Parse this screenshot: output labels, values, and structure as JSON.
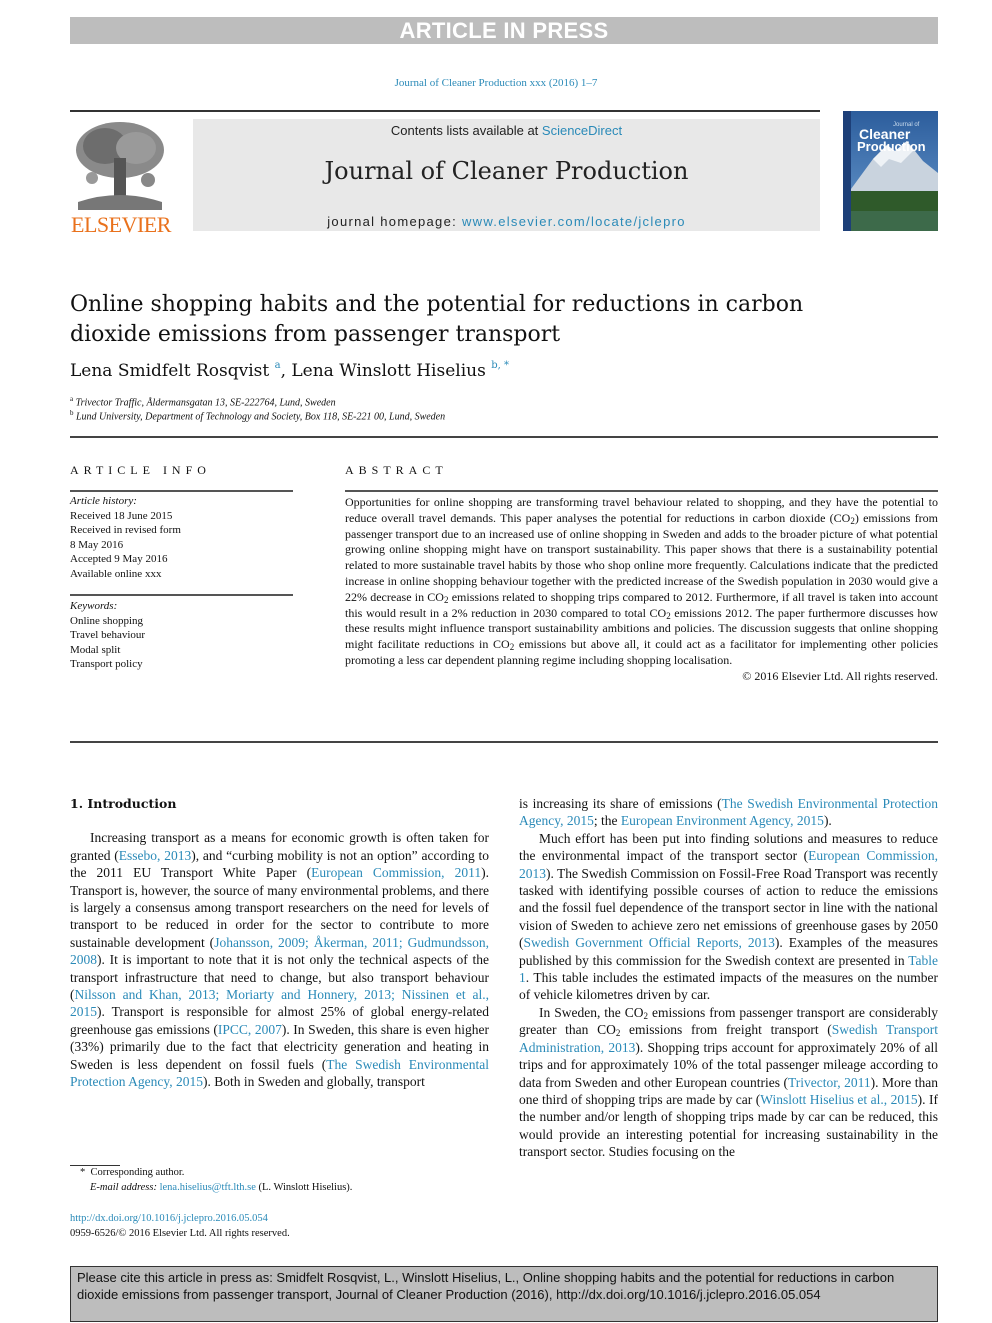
{
  "banner": {
    "text": "ARTICLE IN PRESS"
  },
  "journal_ref": "Journal of Cleaner Production xxx (2016) 1–7",
  "masthead": {
    "contents_prefix": "Contents lists available at ",
    "contents_link": "ScienceDirect",
    "journal_title": "Journal of Cleaner Production",
    "homepage_prefix": "journal homepage: ",
    "homepage_link": "www.elsevier.com/locate/jclepro",
    "publisher_logo": "ELSEVIER",
    "cover": {
      "line1": "Journal of",
      "line2": "Cleaner",
      "line3": "Production"
    }
  },
  "article": {
    "title": "Online shopping habits and the potential for reductions in carbon dioxide emissions from passenger transport",
    "authors": [
      {
        "name": "Lena Smidfelt Rosqvist",
        "sup": "a"
      },
      {
        "name": "Lena Winslott Hiselius",
        "sup": "b, *"
      }
    ],
    "affiliations": [
      {
        "key": "a",
        "text": "Trivector Traffic, Åldermansgatan 13, SE-222764, Lund, Sweden"
      },
      {
        "key": "b",
        "text": "Lund University, Department of Technology and Society, Box 118, SE-221 00, Lund, Sweden"
      }
    ]
  },
  "article_info": {
    "heading": "ARTICLE INFO",
    "history_label": "Article history:",
    "history": [
      "Received 18 June 2015",
      "Received in revised form",
      "8 May 2016",
      "Accepted 9 May 2016",
      "Available online xxx"
    ],
    "keywords_label": "Keywords:",
    "keywords": [
      "Online shopping",
      "Travel behaviour",
      "Modal split",
      "Transport policy"
    ]
  },
  "abstract": {
    "heading": "ABSTRACT",
    "p1": "Opportunities for online shopping are transforming travel behaviour related to shopping, and they have the potential to reduce overall travel demands. This paper analyses the potential for reductions in carbon dioxide (CO",
    "p2": ") emissions from passenger transport due to an increased use of online shopping in Sweden and adds to the broader picture of what potential growing online shopping might have on transport sustainability. This paper shows that there is a sustainability potential related to more sustainable travel habits by those who shop online more frequently. Calculations indicate that the predicted increase in online shopping behaviour together with the predicted increase of the Swedish population in 2030 would give a 22% decrease in CO",
    "p3": " emissions related to shopping trips compared to 2012. Furthermore, if all travel is taken into account this would result in a 2% reduction in 2030 compared to total CO",
    "p4": " emissions 2012. The paper furthermore discusses how these results might influence transport sustainability ambitions and policies. The discussion suggests that online shopping might facilitate reductions in CO",
    "p5": " emissions but above all, it could act as a facilitator for implementing other policies promoting a less car dependent planning regime including shopping localisation.",
    "sub": "2",
    "copyright": "© 2016 Elsevier Ltd. All rights reserved."
  },
  "intro": {
    "heading": "1.  Introduction",
    "left": {
      "t1": "Increasing transport as a means for economic growth is often taken for granted (",
      "l1": "Essebo, 2013",
      "t2": "), and “curbing mobility is not an option” according to the 2011 EU Transport White Paper (",
      "l2": "European Commission, 2011",
      "t3": "). Transport is, however, the source of many environmental problems, and there is largely a consensus among transport researchers on the need for levels of transport to be reduced in order for the sector to contribute to more sustainable development (",
      "l3": "Johansson, 2009; Åkerman, 2011; Gudmundsson, 2008",
      "t4": "). It is important to note that it is not only the technical aspects of the transport infrastructure that need to change, but also transport behaviour (",
      "l4": "Nilsson and Khan, 2013; Moriarty and Honnery, 2013; Nissinen et al., 2015",
      "t5": "). Transport is responsible for almost 25% of global energy-related greenhouse gas emissions (",
      "l5": "IPCC, 2007",
      "t6": "). In Sweden, this share is even higher (33%) primarily due to the fact that electricity generation and heating in Sweden is less dependent on fossil fuels (",
      "l6": "The Swedish Environmental Protection Agency, 2015",
      "t7": "). Both in Sweden and globally, transport"
    },
    "right": {
      "a1": "is increasing its share of emissions (",
      "al1": "The Swedish Environmental Protection Agency, 2015",
      "a2": "; the ",
      "al2": "European Environment Agency, 2015",
      "a3": ").",
      "b1": "Much effort has been put into finding solutions and measures to reduce the environmental impact of the transport sector (",
      "bl1": "European Commission, 2013",
      "b2": "). The Swedish Commission on Fossil-Free Road Transport was recently tasked with identifying possible courses of action to reduce the emissions and the fossil fuel dependence of the transport sector in line with the national vision of Sweden to achieve zero net emissions of greenhouse gases by 2050 (",
      "bl2": "Swedish Government Official Reports, 2013",
      "b3": "). Examples of the measures published by this commission for the Swedish context are presented in ",
      "bl3": "Table 1",
      "b4": ". This table includes the estimated impacts of the measures on the number of vehicle kilometres driven by car.",
      "c1": "In Sweden, the CO",
      "c2": " emissions from passenger transport are considerably greater than CO",
      "c3": " emissions from freight transport (",
      "cl1": "Swedish Transport Administration, 2013",
      "c4": "). Shopping trips account for approximately 20% of all trips and for approximately 10% of the total passenger mileage according to data from Sweden and other European countries (",
      "cl2": "Trivector, 2011",
      "c5": "). More than one third of shopping trips are made by car (",
      "cl3": "Winslott Hiselius et al., 2015",
      "c6": "). If the number and/or length of shopping trips made by car can be reduced, this would provide an interesting potential for increasing sustainability in the transport sector. Studies focusing on the"
    }
  },
  "footnote": {
    "star": "*",
    "corresponding": "Corresponding author.",
    "email_label": "E-mail address: ",
    "email": "lena.hiselius@tft.lth.se",
    "email_suffix": " (L. Winslott Hiselius)."
  },
  "doi": {
    "link": "http://dx.doi.org/10.1016/j.jclepro.2016.05.054",
    "issn": "0959-6526/© 2016 Elsevier Ltd. All rights reserved."
  },
  "cite_box": "Please cite this article in press as: Smidfelt Rosqvist, L., Winslott Hiselius, L., Online shopping habits and the potential for reductions in carbon dioxide emissions from passenger transport, Journal of Cleaner Production (2016), http://dx.doi.org/10.1016/j.jclepro.2016.05.054",
  "colors": {
    "link": "#2a8ab8",
    "elsevier_orange": "#e9711c",
    "banner_gray": "#bdbdbd",
    "masthead_gray": "#e8e8e8"
  }
}
